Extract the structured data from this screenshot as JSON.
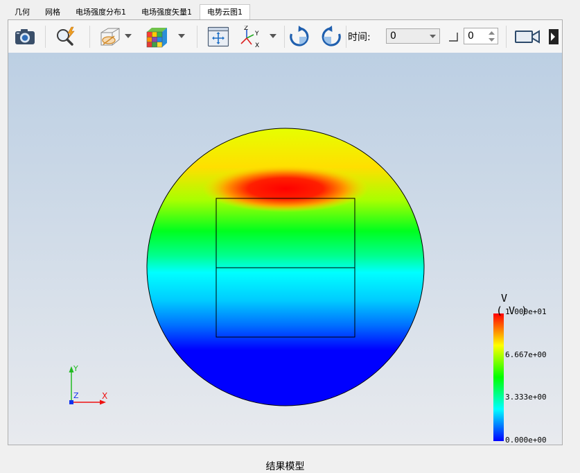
{
  "tabs": [
    {
      "label": "几何",
      "active": false
    },
    {
      "label": "网格",
      "active": false
    },
    {
      "label": "电场强度分布1",
      "active": false
    },
    {
      "label": "电场强度矢量1",
      "active": false
    },
    {
      "label": "电势云图1",
      "active": true
    }
  ],
  "toolbar": {
    "icons": [
      "camera-icon",
      "zoom-icon",
      "clip-plane-icon",
      "color-cube-icon",
      "fit-view-icon",
      "axes-orient-icon",
      "rotate-cw-icon",
      "rotate-ccw-icon",
      "video-camera-icon",
      "more-icon"
    ],
    "time_label": "时间:",
    "time_value": "0",
    "frame_value": "0"
  },
  "view": {
    "caption": "结果模型",
    "triad": {
      "x": "X",
      "y": "Y",
      "z": "Z"
    }
  },
  "colorbar": {
    "title": "V",
    "unit": "( V )",
    "ticks": [
      "1.000e+01",
      "6.667e+00",
      "3.333e+00",
      "0.000e+00"
    ],
    "colors": [
      "#ff0000",
      "#ffff00",
      "#00ff00",
      "#00ffff",
      "#0000ff"
    ],
    "min": 0,
    "max": 10
  }
}
